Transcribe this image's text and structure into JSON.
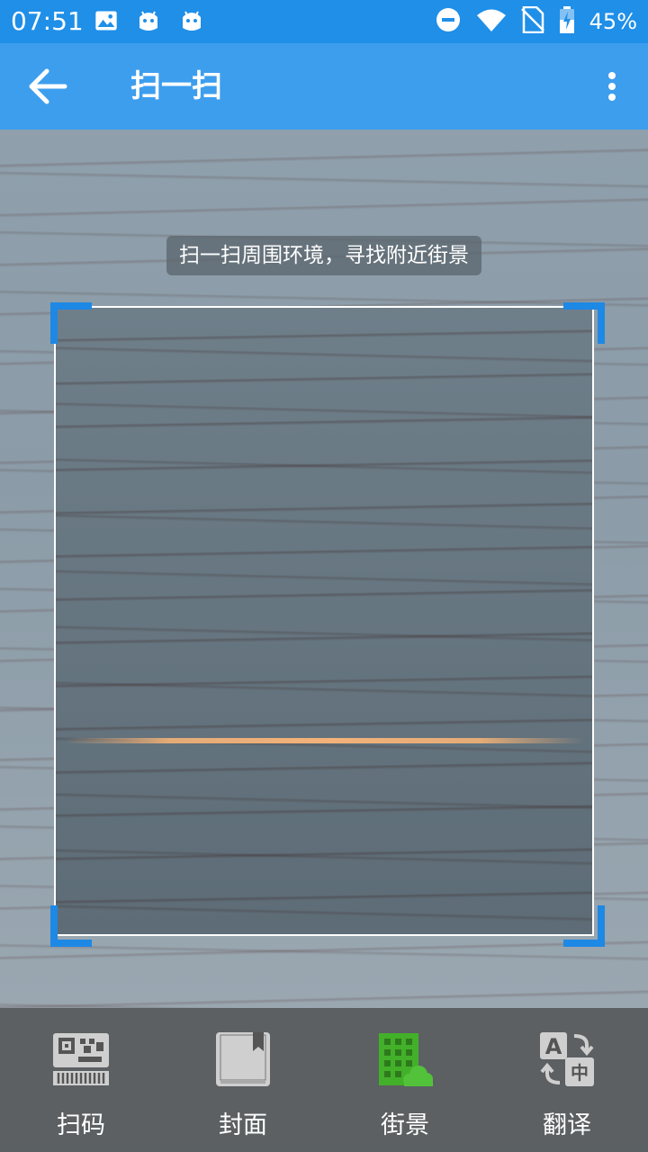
{
  "status_bar": {
    "time": "07:51",
    "battery": "45%",
    "left_icons": [
      "image-icon",
      "android-icon",
      "android-icon"
    ],
    "right_icons": [
      "do-not-disturb-icon",
      "wifi-icon",
      "no-sim-icon",
      "battery-charging-icon"
    ]
  },
  "app_bar": {
    "title": "扫一扫",
    "back_icon": "arrow-back-icon",
    "menu_icon": "more-vert-icon"
  },
  "scanner": {
    "hint": "扫一扫周围环境，寻找附近街景"
  },
  "bottom_nav": {
    "items": [
      {
        "label": "扫码",
        "icon": "qr-barcode-icon",
        "active": false
      },
      {
        "label": "封面",
        "icon": "book-cover-icon",
        "active": false
      },
      {
        "label": "街景",
        "icon": "street-building-icon",
        "active": true
      },
      {
        "label": "翻译",
        "icon": "translate-icon",
        "active": false
      }
    ]
  },
  "colors": {
    "status_bar": "#1f8fe8",
    "app_bar": "#3d9eee",
    "corner_accent": "#1e88e5",
    "active_icon": "#43b02a",
    "inactive_icon": "#cfcfcf",
    "scan_line": "#f4b27a"
  }
}
